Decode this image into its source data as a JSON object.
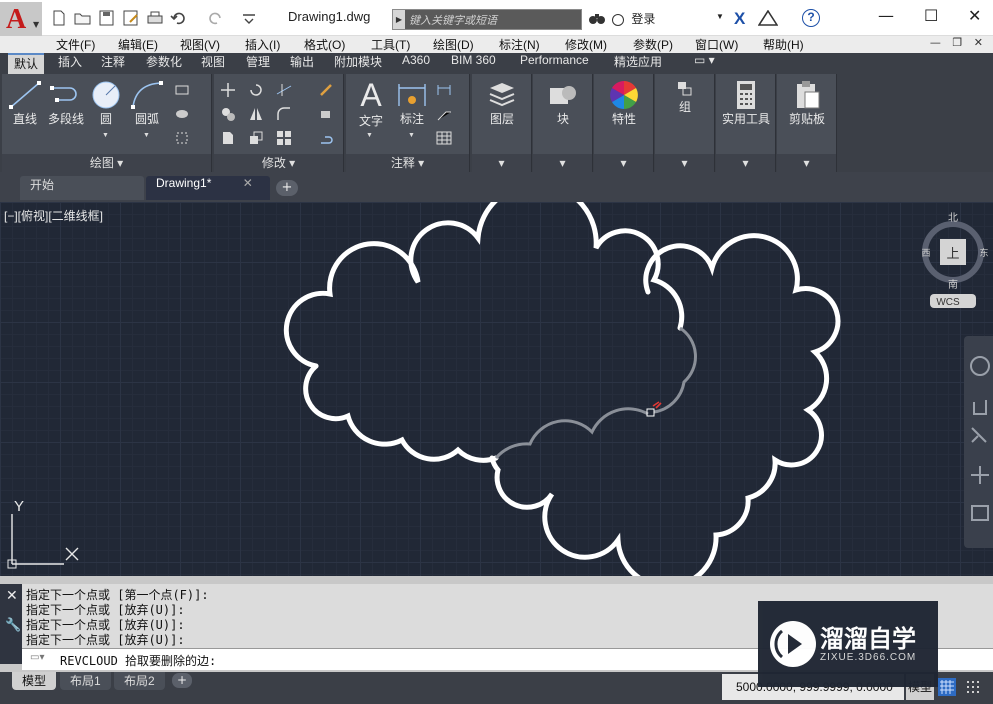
{
  "titlebar": {
    "doc_title": "Drawing1.dwg",
    "search_placeholder": "键入关键字或短语",
    "login_label": "登录",
    "help_label": "?",
    "minimize": "—",
    "maximize": "☐",
    "close": "✕"
  },
  "menus": [
    "文件(F)",
    "编辑(E)",
    "视图(V)",
    "插入(I)",
    "格式(O)",
    "工具(T)",
    "绘图(D)",
    "标注(N)",
    "修改(M)",
    "参数(P)",
    "窗口(W)",
    "帮助(H)"
  ],
  "ribbon_tabs": [
    "默认",
    "插入",
    "注释",
    "参数化",
    "视图",
    "管理",
    "输出",
    "附加模块",
    "A360",
    "BIM 360",
    "Performance",
    "精选应用"
  ],
  "panels": {
    "draw": {
      "title": "绘图",
      "tools": [
        "直线",
        "多段线",
        "圆",
        "圆弧"
      ]
    },
    "modify": {
      "title": "修改"
    },
    "annotation": {
      "title": "注释",
      "tools": [
        "文字",
        "标注"
      ]
    },
    "layers": {
      "label": "图层"
    },
    "block": {
      "label": "块"
    },
    "properties": {
      "label": "特性"
    },
    "group": {
      "label": "组"
    },
    "utilities": {
      "label": "实用工具"
    },
    "clipboard": {
      "label": "剪贴板"
    }
  },
  "doc_tabs": [
    {
      "label": "开始"
    },
    {
      "label": "Drawing1*",
      "close": "✕"
    }
  ],
  "canvas": {
    "view_label": "[−][俯视][二维线框]",
    "viewcube": {
      "north": "北",
      "south": "南",
      "east": "东",
      "west": "西",
      "face": "上",
      "wcs": "WCS"
    },
    "ucs": {
      "x": "X",
      "y": "Y"
    }
  },
  "command": {
    "history": [
      "指定下一个点或 [第一个点(F)]:",
      "指定下一个点或 [放弃(U)]:",
      "指定下一个点或 [放弃(U)]:",
      "指定下一个点或 [放弃(U)]:"
    ],
    "prompt": "REVCLOUD 拾取要删除的边:"
  },
  "status": {
    "layout_tabs": [
      "模型",
      "布局1",
      "布局2"
    ],
    "coords": "5000.0000, 999.9999, 0.0000",
    "model_label": "模型"
  },
  "watermark": {
    "title": "溜溜自学",
    "url": "ZIXUE.3D66.COM"
  },
  "colors": {
    "accent": "#5b89c6",
    "canvas_bg": "#212836",
    "cloud": "#ffffff",
    "logo_red": "#c41b1b"
  }
}
